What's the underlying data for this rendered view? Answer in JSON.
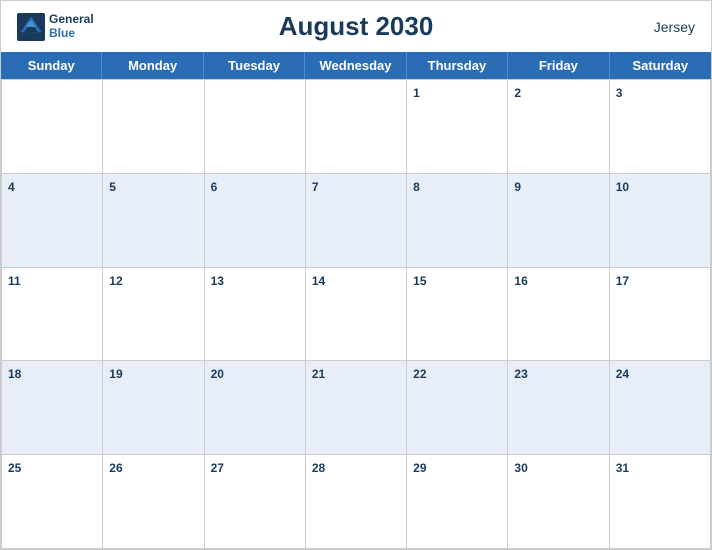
{
  "header": {
    "title": "August 2030",
    "region": "Jersey",
    "logo_general": "General",
    "logo_blue": "Blue"
  },
  "days_of_week": [
    "Sunday",
    "Monday",
    "Tuesday",
    "Wednesday",
    "Thursday",
    "Friday",
    "Saturday"
  ],
  "weeks": [
    [
      null,
      null,
      null,
      null,
      1,
      2,
      3
    ],
    [
      4,
      5,
      6,
      7,
      8,
      9,
      10
    ],
    [
      11,
      12,
      13,
      14,
      15,
      16,
      17
    ],
    [
      18,
      19,
      20,
      21,
      22,
      23,
      24
    ],
    [
      25,
      26,
      27,
      28,
      29,
      30,
      31
    ]
  ],
  "dark_rows": [
    1,
    3
  ]
}
